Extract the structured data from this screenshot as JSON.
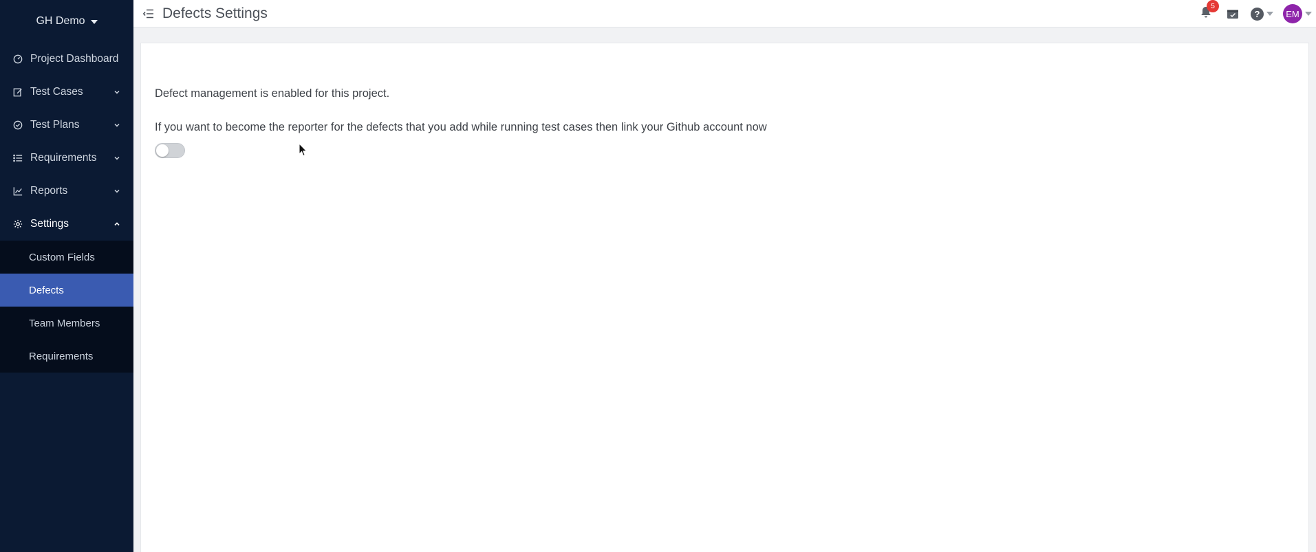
{
  "sidebar": {
    "project_name": "GH Demo",
    "items": [
      {
        "label": "Project Dashboard",
        "icon": "gauge-icon"
      },
      {
        "label": "Test Cases",
        "icon": "edit-icon"
      },
      {
        "label": "Test Plans",
        "icon": "check-circle-icon"
      },
      {
        "label": "Requirements",
        "icon": "list-icon"
      },
      {
        "label": "Reports",
        "icon": "chart-line-icon"
      },
      {
        "label": "Settings",
        "icon": "gear-icon"
      }
    ],
    "settings_sub": [
      {
        "label": "Custom Fields"
      },
      {
        "label": "Defects"
      },
      {
        "label": "Team Members"
      },
      {
        "label": "Requirements"
      }
    ]
  },
  "header": {
    "title": "Defects Settings",
    "notification_count": "5",
    "help_glyph": "?",
    "user_initials": "EM"
  },
  "content": {
    "status_message": "Defect management is enabled for this project.",
    "link_prompt": "If you want to become the reporter for the defects that you add while running test cases then link your Github account now",
    "toggle_on": false
  },
  "colors": {
    "sidebar_bg": "#0b1a33",
    "active_item": "#3a5bb1",
    "badge": "#e53935",
    "avatar": "#8e24aa"
  }
}
